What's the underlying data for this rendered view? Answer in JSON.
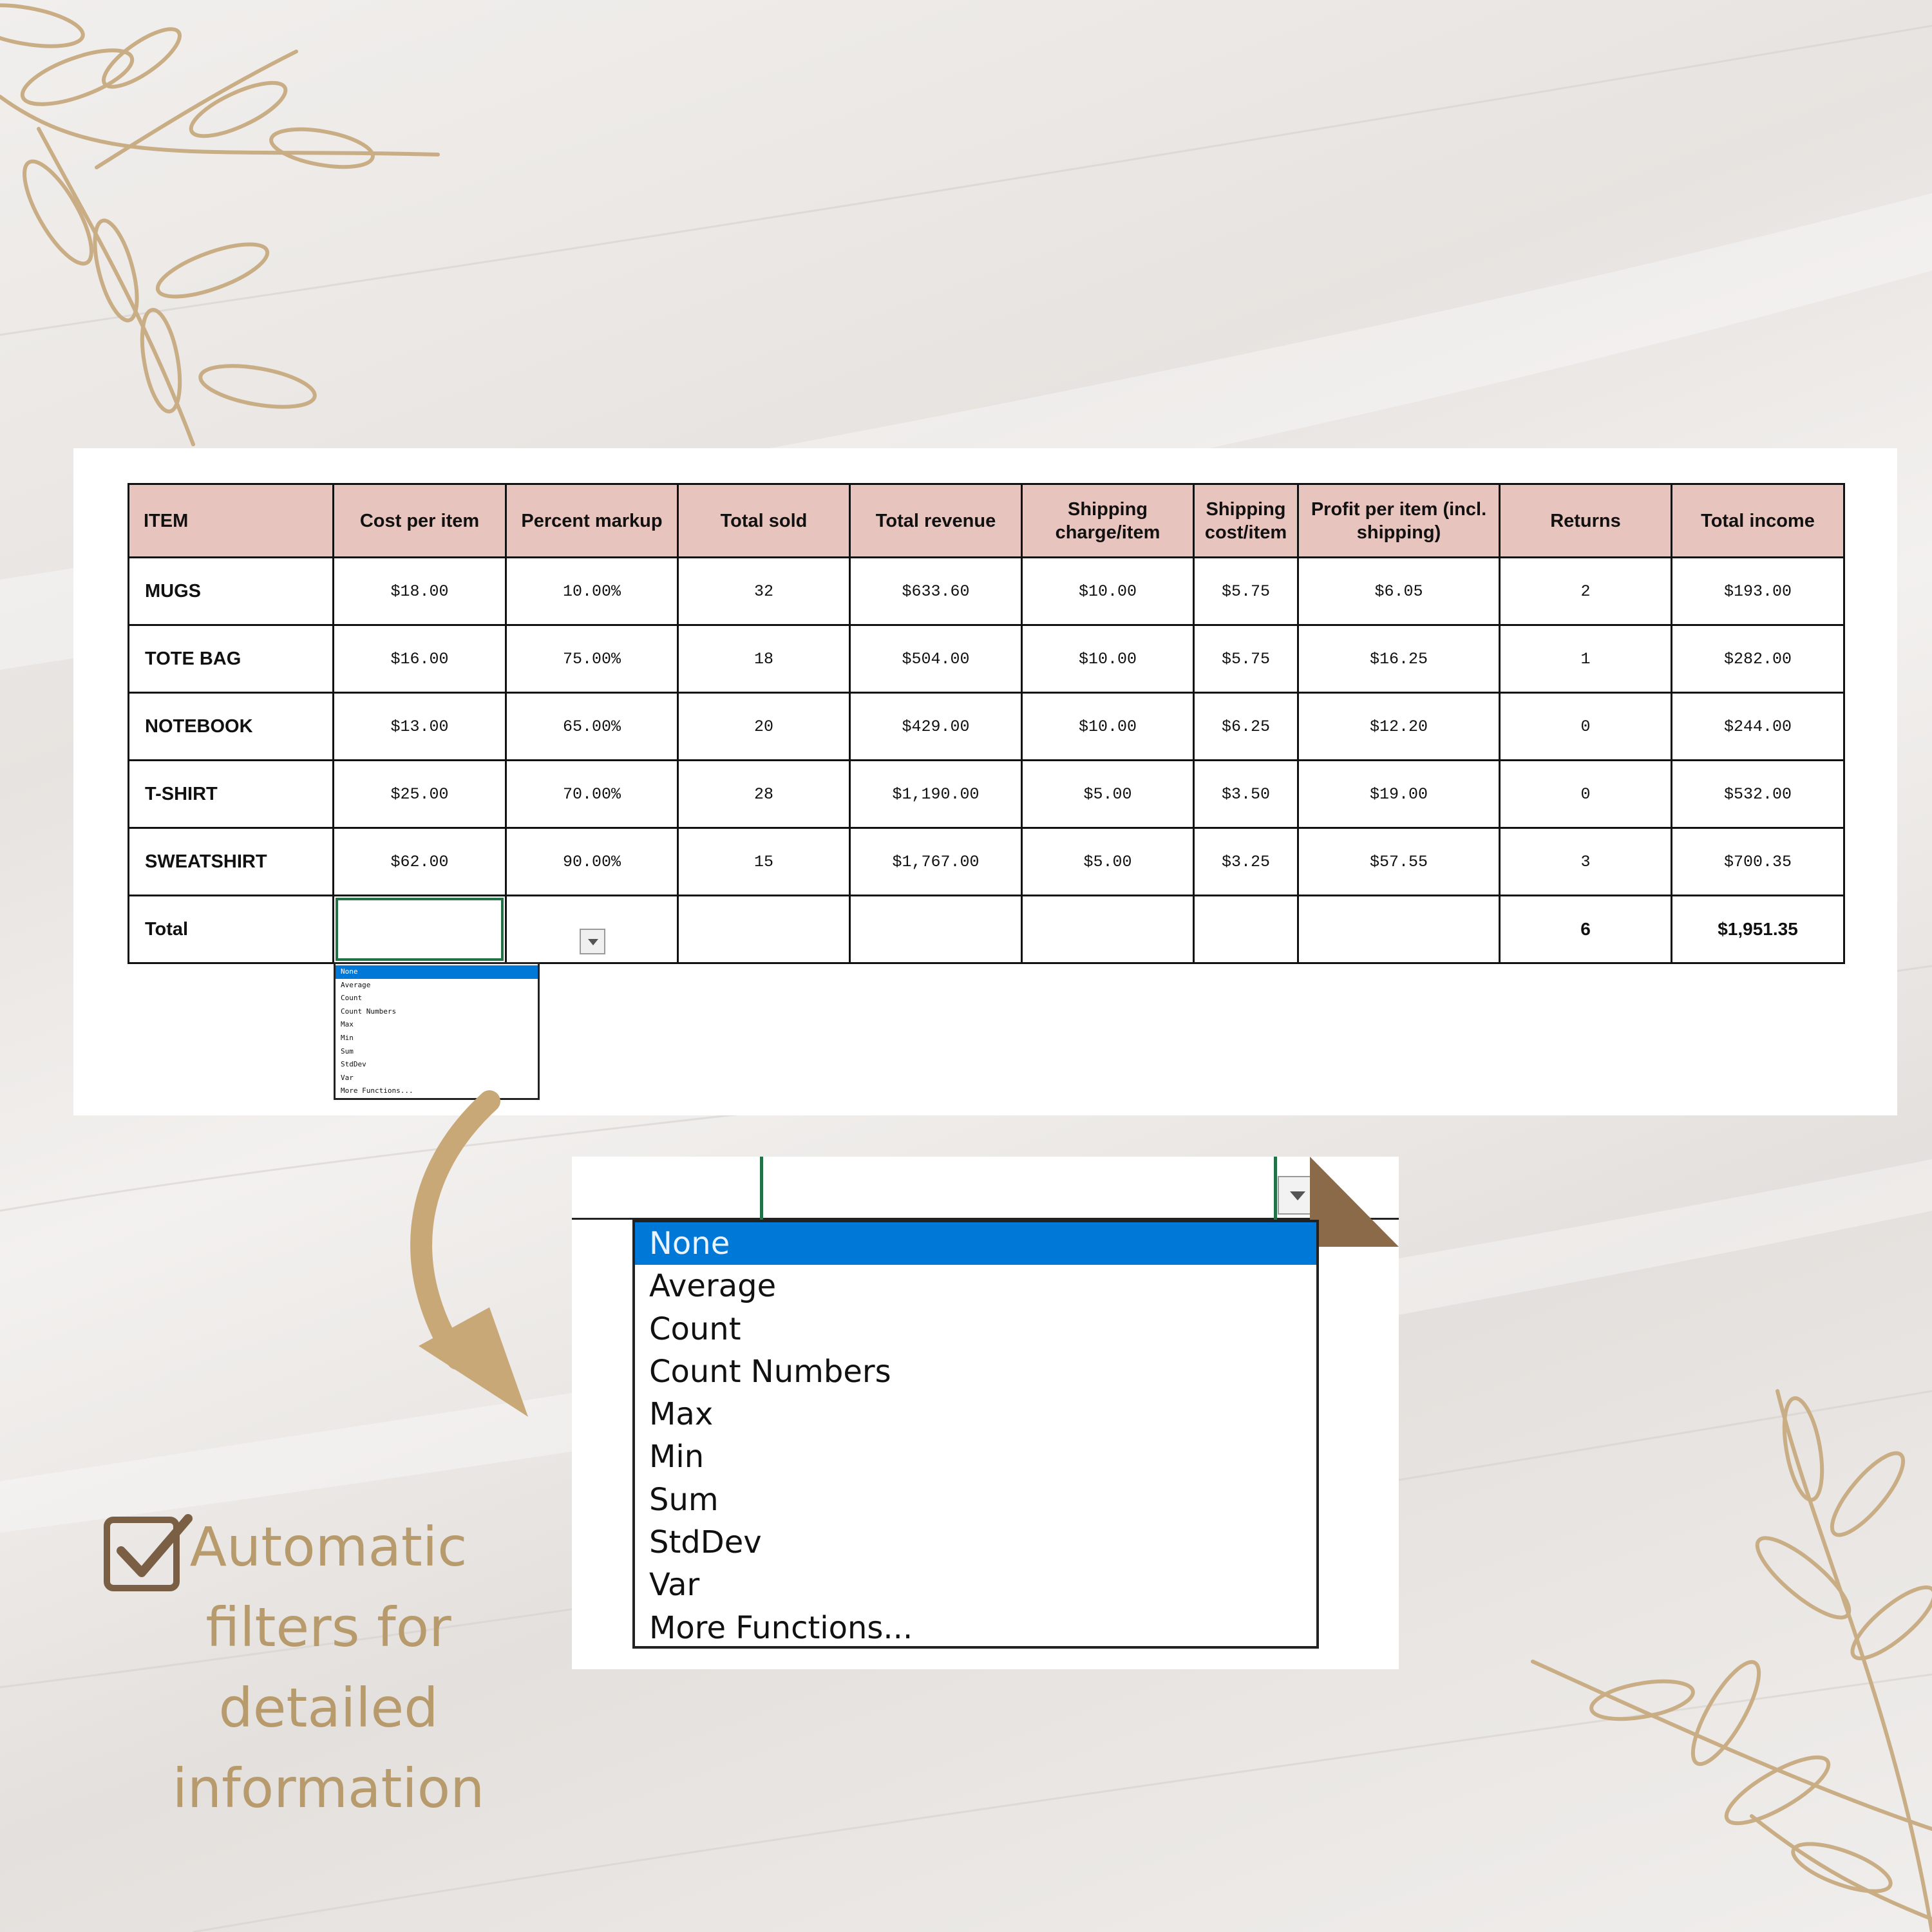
{
  "colors": {
    "header_fill": "#e7c4bd",
    "accent_gold": "#b89b6d",
    "selection_green": "#217346",
    "highlight_blue": "#0078d7",
    "corner_brown": "#8b6a4a"
  },
  "table": {
    "headers": [
      "ITEM",
      "Cost per item",
      "Percent markup",
      "Total sold",
      "Total revenue",
      "Shipping charge/item",
      "Shipping cost/item",
      "Profit per item (incl. shipping)",
      "Returns",
      "Total income"
    ],
    "rows": [
      [
        "MUGS",
        "$18.00",
        "10.00%",
        "32",
        "$633.60",
        "$10.00",
        "$5.75",
        "$6.05",
        "2",
        "$193.00"
      ],
      [
        "TOTE BAG",
        "$16.00",
        "75.00%",
        "18",
        "$504.00",
        "$10.00",
        "$5.75",
        "$16.25",
        "1",
        "$282.00"
      ],
      [
        "NOTEBOOK",
        "$13.00",
        "65.00%",
        "20",
        "$429.00",
        "$10.00",
        "$6.25",
        "$12.20",
        "0",
        "$244.00"
      ],
      [
        "T-SHIRT",
        "$25.00",
        "70.00%",
        "28",
        "$1,190.00",
        "$5.00",
        "$3.50",
        "$19.00",
        "0",
        "$532.00"
      ],
      [
        "SWEATSHIRT",
        "$62.00",
        "90.00%",
        "15",
        "$1,767.00",
        "$5.00",
        "$3.25",
        "$57.55",
        "3",
        "$700.35"
      ]
    ],
    "total_row": {
      "label": "Total",
      "returns": "6",
      "income": "$1,951.35"
    }
  },
  "dropdown": {
    "selected": "None",
    "options": [
      "None",
      "Average",
      "Count",
      "Count Numbers",
      "Max",
      "Min",
      "Sum",
      "StdDev",
      "Var",
      "More Functions..."
    ]
  },
  "caption": {
    "line1": "Automatic",
    "line2": "filters for",
    "line3": "detailed",
    "line4": "information"
  },
  "icons": {
    "dropdown_arrow": "chevron-down-icon",
    "arrow": "curved-arrow-icon",
    "check": "checkbox-checked-icon",
    "leaves": "leaf-branch-icon"
  }
}
